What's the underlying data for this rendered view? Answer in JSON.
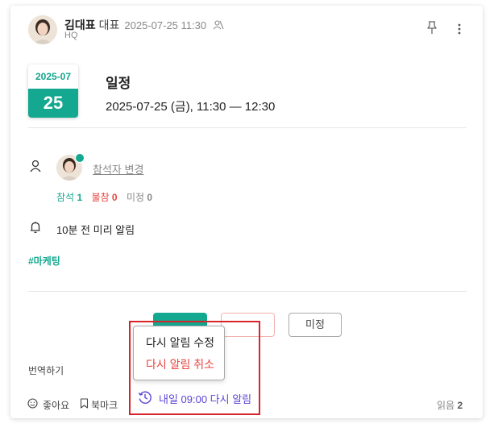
{
  "post": {
    "author_name": "김대표",
    "author_role": "대표",
    "date": "2025-07-25 11:30",
    "org": "HQ"
  },
  "event": {
    "badge_month": "2025-07",
    "badge_day": "25",
    "title": "일정",
    "time_range": "2025-07-25 (금), 11:30 — 12:30"
  },
  "attendees": {
    "change_link": "참석자 변경",
    "attend_label": "참석",
    "attend_count": "1",
    "absent_label": "불참",
    "absent_count": "0",
    "undecided_label": "미정",
    "undecided_count": "0"
  },
  "reminder": {
    "text": "10분 전 미리 알림"
  },
  "tag": "#마케팅",
  "rsvp": {
    "undecided_button": "미정"
  },
  "reminder_menu": {
    "edit": "다시 알림 수정",
    "cancel": "다시 알림 취소",
    "scheduled": "내일 09:00 다시 알림"
  },
  "footer": {
    "translate": "번역하기",
    "like": "좋아요",
    "bookmark": "북마크",
    "read_label": "읽음",
    "read_count": "2"
  },
  "colors": {
    "accent": "#13a88f",
    "absent": "#e8433d",
    "reminder": "#5b45d6",
    "highlight": "#d9232b"
  }
}
